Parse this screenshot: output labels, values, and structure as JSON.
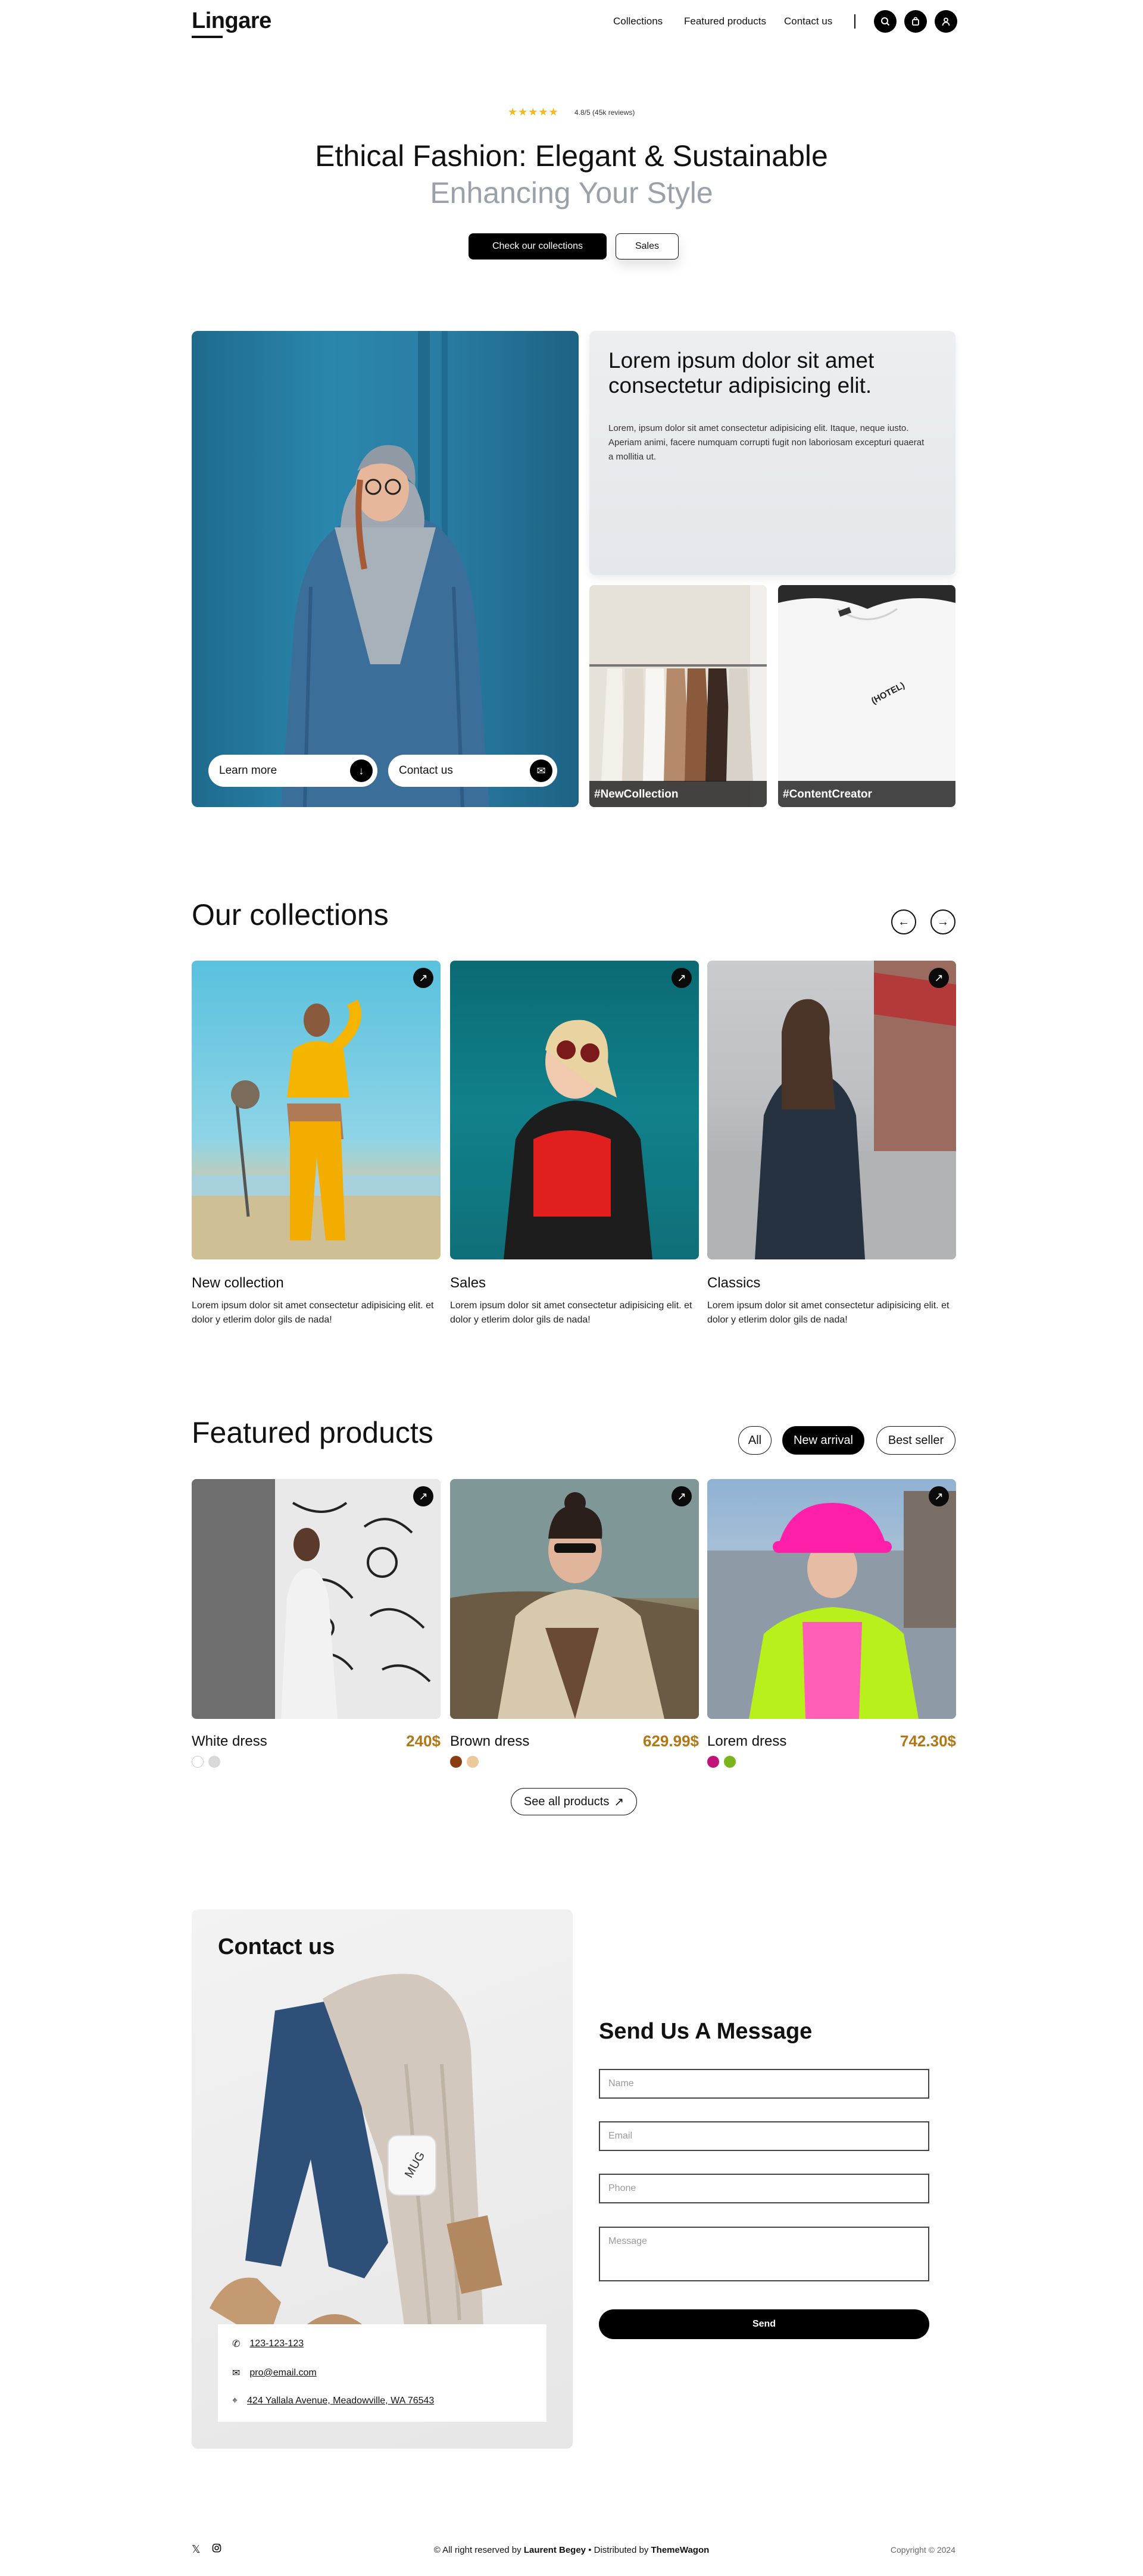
{
  "header": {
    "logo": "Lingare",
    "nav": [
      "Collections",
      "Featured products",
      "Contact us"
    ],
    "icons": [
      "search-icon",
      "bag-icon",
      "user-icon"
    ]
  },
  "hero": {
    "stars": "★★★★★",
    "rating": "4.8/5 (45k reviews)",
    "title": "Ethical Fashion: Elegant & Sustainable",
    "subtitle": "Enhancing Your Style",
    "primary_button": "Check our collections",
    "secondary_button": "Sales"
  },
  "feature": {
    "learn_more": "Learn more",
    "contact_us": "Contact us",
    "card_title": "Lorem ipsum dolor sit amet consectetur adipisicing elit.",
    "card_body": "Lorem, ipsum dolor sit amet consectetur adipisicing elit. Itaque, neque iusto. Aperiam animi, facere numquam corrupti fugit non laboriosam excepturi quaerat a mollitia ut.",
    "tile1_label": "#NewCollection",
    "tile2_label": "#ContentCreator",
    "tile2_shirt_text": "(HOTEL)"
  },
  "collections": {
    "title": "Our collections",
    "items": [
      {
        "title": "New collection",
        "desc": "Lorem ipsum dolor sit amet consectetur adipisicing elit. et dolor y etlerim dolor gils de nada!"
      },
      {
        "title": "Sales",
        "desc": "Lorem ipsum dolor sit amet consectetur adipisicing elit. et dolor y etlerim dolor gils de nada!"
      },
      {
        "title": "Classics",
        "desc": "Lorem ipsum dolor sit amet consectetur adipisicing elit. et dolor y etlerim dolor gils de nada!"
      }
    ]
  },
  "featured": {
    "title": "Featured products",
    "filters": [
      "All",
      "New arrival",
      "Best seller"
    ],
    "active_filter": "New arrival",
    "products": [
      {
        "name": "White dress",
        "price": "240$",
        "swatches": [
          "#ffffff",
          "#d9d9d9"
        ]
      },
      {
        "name": "Brown dress",
        "price": "629.99$",
        "swatches": [
          "#8a3d10",
          "#ecc99a"
        ]
      },
      {
        "name": "Lorem dress",
        "price": "742.30$",
        "swatches": [
          "#c2127a",
          "#7bb51c"
        ]
      }
    ],
    "see_all": "See all products"
  },
  "contact": {
    "title": "Contact us",
    "phone": "123-123-123",
    "email": "pro@email.com",
    "address": "424 Yallala Avenue, Meadowville, WA 76543",
    "mug_text": "MUG"
  },
  "form": {
    "title": "Send Us A Message",
    "name_placeholder": "Name",
    "email_placeholder": "Email",
    "phone_placeholder": "Phone",
    "message_placeholder": "Message",
    "send": "Send"
  },
  "footer": {
    "prefix": "© All right reserved by ",
    "author": "Laurent Begey",
    "middle": " • Distributed by ",
    "distributor": "ThemeWagon",
    "copyright": "Copyright © 2024"
  }
}
